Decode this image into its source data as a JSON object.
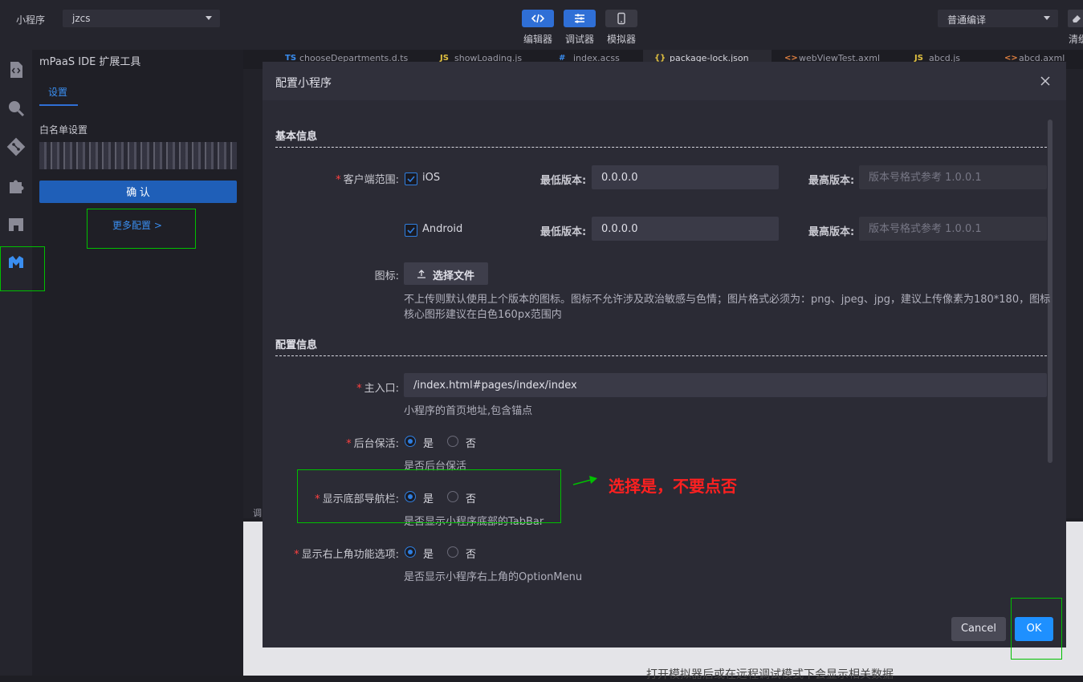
{
  "topbar": {
    "project_label": "小程序",
    "project_value": "jzcs",
    "tools": [
      {
        "label": "编辑器",
        "icon": "code-icon",
        "active": true
      },
      {
        "label": "调试器",
        "icon": "sliders-icon",
        "active": false
      },
      {
        "label": "模拟器",
        "icon": "phone-icon",
        "active": false
      }
    ],
    "compile_mode": "普通编译",
    "clear_label": "清缓"
  },
  "side": {
    "title": "mPaaS IDE 扩展工具",
    "tab": "设置",
    "section": "白名单设置",
    "confirm_label": "确 认",
    "more_label": "更多配置 >"
  },
  "editor_tabs": [
    {
      "icon": "TS",
      "label": "chooseDepartments.d.ts",
      "color": "#3a8ef0"
    },
    {
      "icon": "JS",
      "label": "showLoading.js",
      "color": "#e0c040"
    },
    {
      "icon": "#",
      "label": "index.acss",
      "color": "#3a8ef0"
    },
    {
      "icon": "{}",
      "label": "package-lock.json",
      "color": "#e0c040",
      "active": true
    },
    {
      "icon": "<>",
      "label": "webViewTest.axml",
      "color": "#e08040"
    },
    {
      "icon": "JS",
      "label": "abcd.js",
      "color": "#e0c040"
    },
    {
      "icon": "<>",
      "label": "abcd.axml",
      "color": "#e08040"
    }
  ],
  "background": {
    "debug_label": "调",
    "simulator_text": "打开模拟器后或在远程调试模式下会显示相关数据"
  },
  "modal": {
    "title": "配置小程序",
    "basic_section": "基本信息",
    "client_range_label": "客户端范围:",
    "ios_label": "iOS",
    "android_label": "Android",
    "min_version_label": "最低版本:",
    "max_version_label": "最高版本:",
    "ios_min_value": "0.0.0.0",
    "android_min_value": "0.0.0.0",
    "version_placeholder": "版本号格式参考 1.0.0.1",
    "icon_label": "图标:",
    "choose_file_label": "选择文件",
    "icon_hint_line1": "不上传则默认使用上个版本的图标。图标不允许涉及政治敏感与色情；图片格式必须为：png、jpeg、jpg，建议上传像素为180*180，图标",
    "icon_hint_line2": "核心图形建议在白色160px范围内",
    "config_section": "配置信息",
    "main_entry_label": "主入口:",
    "main_entry_value": "/index.html#pages/index/index",
    "main_entry_hint": "小程序的首页地址,包含锚点",
    "keepalive_label": "后台保活:",
    "keepalive_hint": "是否后台保活",
    "tabbar_label": "显示底部导航栏:",
    "tabbar_hint": "是否显示小程序底部的TabBar",
    "optionmenu_label": "显示右上角功能选项:",
    "optionmenu_hint": "是否显示小程序右上角的OptionMenu",
    "yes": "是",
    "no": "否",
    "cancel_label": "Cancel",
    "ok_label": "OK"
  },
  "annotation_text": "选择是，不要点否",
  "colors": {
    "accent": "#2f6fd6",
    "ok": "#1e90ff",
    "annotation": "#00c000",
    "annotation_text": "#ff2020"
  }
}
